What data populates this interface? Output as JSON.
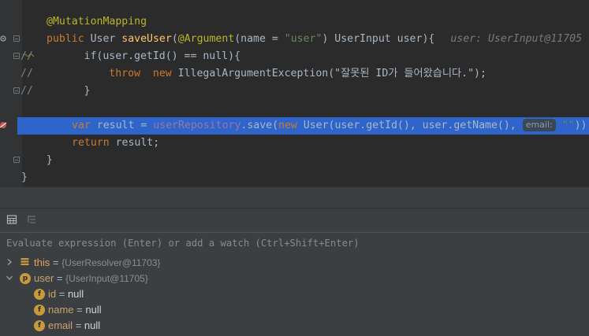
{
  "editor": {
    "lines": {
      "l1": "@MutationMapping",
      "l2_kw": "public ",
      "l2_type": "User ",
      "l2_fn": "saveUser",
      "l2_open": "(",
      "l2_ann": "@Argument",
      "l2_name": "(name = ",
      "l2_str": "\"user\"",
      "l2_rest": ") UserInput user){",
      "l2_inlay": "user: UserInput@11705",
      "l3": "        if(user.getId() == null){",
      "l4_pre": "            ",
      "l4_kw1": "throw",
      "l4_mid": "  ",
      "l4_kw2": "new",
      "l4_rest": " IllegalArgumentException(\"잘못된 ID가 들어왔습니다.\");",
      "l5": "        }",
      "l6_kw": "var",
      "l6_a": " result = ",
      "l6_field": "userRepository",
      "l6_b": ".save(",
      "l6_new": "new",
      "l6_c": " User(user.getId(), user.getName(), ",
      "l6_inlay": "email:",
      "l6_str": " \"\"",
      "l6_end": "))",
      "l7_kw": "return",
      "l7_rest": " result;",
      "l8": "    }",
      "l9": "}",
      "comment1": "//",
      "comment2": "//",
      "comment3": "//"
    }
  },
  "debug": {
    "eval_placeholder": "Evaluate expression (Enter) or add a watch (Ctrl+Shift+Enter)",
    "vars": [
      {
        "name": "this",
        "eq": " = ",
        "value": "{UserResolver@11703}"
      },
      {
        "name": "user",
        "eq": " = ",
        "value": "{UserInput@11705}"
      },
      {
        "name": "id",
        "eq": " = ",
        "value": "null"
      },
      {
        "name": "name",
        "eq": " = ",
        "value": "null"
      },
      {
        "name": "email",
        "eq": " = ",
        "value": "null"
      }
    ],
    "badge_p": "p",
    "badge_f": "f"
  },
  "colors": {
    "selection": "#2f65ca",
    "keyword": "#cc7832",
    "string": "#6a8759",
    "annotation": "#bbb529"
  }
}
